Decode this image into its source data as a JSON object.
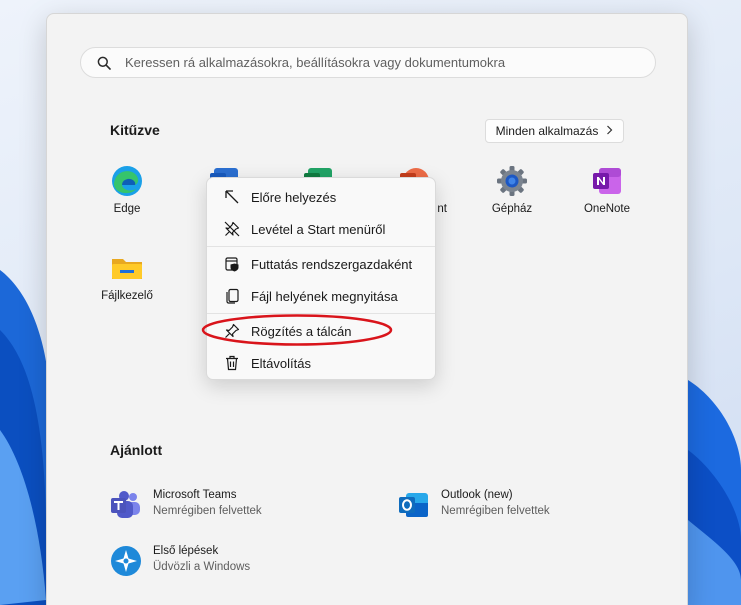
{
  "search": {
    "placeholder": "Keressen rá alkalmazásokra, beállításokra vagy dokumentumokra"
  },
  "pinned": {
    "title": "Kitűzve",
    "all_apps_label": "Minden alkalmazás",
    "apps": [
      {
        "label": "Edge",
        "icon": "edge-icon"
      },
      {
        "label": "nt",
        "icon": "powerpoint-icon"
      },
      {
        "label": "Gépház",
        "icon": "settings-gear-icon"
      },
      {
        "label": "OneNote",
        "icon": "onenote-icon"
      },
      {
        "label": "Fájlkezelő",
        "icon": "folder-icon"
      }
    ]
  },
  "context_menu": {
    "items": [
      {
        "label": "Előre helyezés",
        "icon": "arrow-up-left-icon"
      },
      {
        "label": "Levétel a Start menüről",
        "icon": "unpin-icon"
      },
      {
        "label": "Futtatás rendszergazdaként",
        "icon": "admin-shield-icon"
      },
      {
        "label": "Fájl helyének megnyitása",
        "icon": "open-file-location-icon"
      },
      {
        "label": "Rögzítés a tálcán",
        "icon": "pin-icon"
      },
      {
        "label": "Eltávolítás",
        "icon": "trash-icon"
      }
    ],
    "highlight_color": "#d9141b"
  },
  "recommended": {
    "title": "Ajánlott",
    "items": [
      {
        "name": "Microsoft Teams",
        "sub": "Nemrégiben felvettek",
        "icon": "teams-icon"
      },
      {
        "name": "Outlook (new)",
        "sub": "Nemrégiben felvettek",
        "icon": "outlook-icon"
      },
      {
        "name": "Első lépések",
        "sub": "Üdvözli a Windows",
        "icon": "get-started-icon"
      }
    ]
  }
}
